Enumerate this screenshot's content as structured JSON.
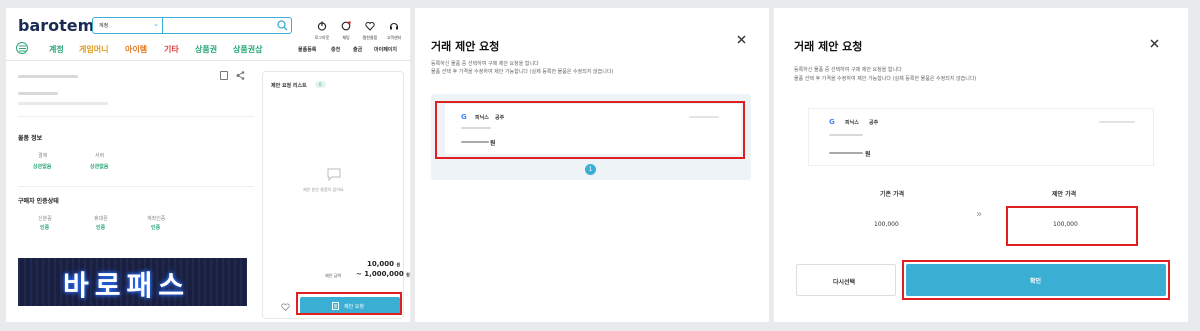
{
  "colors": {
    "accent": "#3aaed3",
    "red": "#e02020",
    "green": "#2aa876",
    "banner": "#1b1f3f"
  },
  "p1": {
    "logo": "barotem",
    "search_select": "계정",
    "header_icons": [
      {
        "icon": "power-icon",
        "label": "로그아웃"
      },
      {
        "icon": "chat-icon",
        "label": "채팅"
      },
      {
        "icon": "heart-icon",
        "label": "찜한물품"
      },
      {
        "icon": "headset-icon",
        "label": "고객센터"
      }
    ],
    "categories": [
      "계정",
      "게임머니",
      "아이템",
      "기타",
      "상품권",
      "상품권삽"
    ],
    "right_nav": [
      "물품등록",
      "충전",
      "출금",
      "마이페이지"
    ],
    "section_item": "물품 정보",
    "item_info": [
      {
        "k": "결제",
        "v": "상관없음"
      },
      {
        "k": "서버",
        "v": "상관없음"
      }
    ],
    "section_buyer": "구매자 인증상태",
    "buyer_info": [
      {
        "k": "신분증",
        "v": "인증"
      },
      {
        "k": "휴대폰",
        "v": "인증"
      },
      {
        "k": "계좌인증",
        "v": "인증"
      }
    ],
    "banner_text": "바로패스",
    "proposal_list_title": "제안 요청 리스트",
    "proposal_count": "0",
    "proposal_empty": "제안 받은 물품이 없어요",
    "price_main": "10,000",
    "price_unit": "원",
    "price_range_label": "제안 금액",
    "price_range": "~ 1,000,000",
    "price_range_unit": "원",
    "proposal_button": "제안 요청"
  },
  "p2": {
    "title": "거래 제안 요청",
    "desc1": "등록하신 물품 중 선택하여 구매 제안 요청을 합니다",
    "desc2": "물품 선택 후 가격을 수정하여 제안 가능합니다 (실제 등록한 물품은 수정되지 않습니다)",
    "card_category": "피닉스",
    "card_server": "공주",
    "card_price_unit": "원",
    "page": "1"
  },
  "p3": {
    "title": "거래 제안 요청",
    "desc1": "등록하신 물품 중 선택하여 구매 제안 요청을 합니다",
    "desc2": "물품 선택 후 가격을 수정하여 제안 가능합니다 (실제 등록한 물품은 수정되지 않습니다)",
    "card_category": "피닉스",
    "card_server": "공주",
    "card_price_unit": "원",
    "orig_price_label": "기존 가격",
    "offer_price_label": "제안 가격",
    "orig_price": "100,000",
    "offer_price": "100,000",
    "arrow": "»",
    "reselect_button": "다시선택",
    "confirm_button": "확인"
  }
}
